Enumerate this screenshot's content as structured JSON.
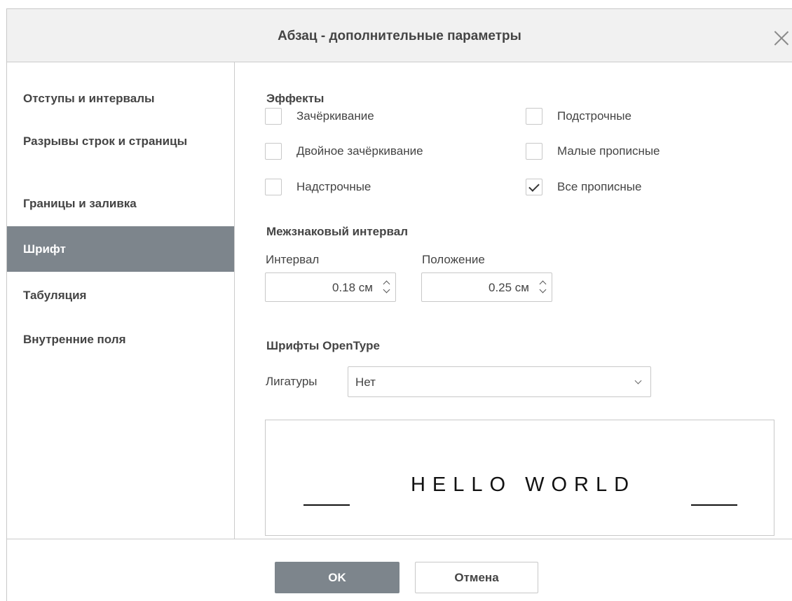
{
  "dialog": {
    "title": "Абзац - дополнительные параметры",
    "close_icon": "close-icon"
  },
  "sidebar": {
    "items": [
      {
        "label": "Отступы и интервалы",
        "active": false
      },
      {
        "label": "Разрывы строк и страницы",
        "active": false
      },
      {
        "label": "Границы и заливка",
        "active": false
      },
      {
        "label": "Шрифт",
        "active": true
      },
      {
        "label": "Табуляция",
        "active": false
      },
      {
        "label": "Внутренние поля",
        "active": false
      }
    ]
  },
  "effects": {
    "title": "Эффекты",
    "strikethrough": {
      "label": "Зачёркивание",
      "checked": false
    },
    "double_strikethrough": {
      "label": "Двойное зачёркивание",
      "checked": false
    },
    "superscript": {
      "label": "Надстрочные",
      "checked": false
    },
    "subscript": {
      "label": "Подстрочные",
      "checked": false
    },
    "small_caps": {
      "label": "Малые прописные",
      "checked": false
    },
    "all_caps": {
      "label": "Все прописные",
      "checked": true
    }
  },
  "spacing": {
    "title": "Межзнаковый интервал",
    "interval_label": "Интервал",
    "interval_value": "0.18 см",
    "position_label": "Положение",
    "position_value": "0.25 см"
  },
  "opentype": {
    "title": "Шрифты OpenType",
    "ligatures_label": "Лигатуры",
    "ligatures_value": "Нет"
  },
  "preview": {
    "text": "HELLO WORLD"
  },
  "footer": {
    "ok_label": "OK",
    "cancel_label": "Отмена"
  }
}
